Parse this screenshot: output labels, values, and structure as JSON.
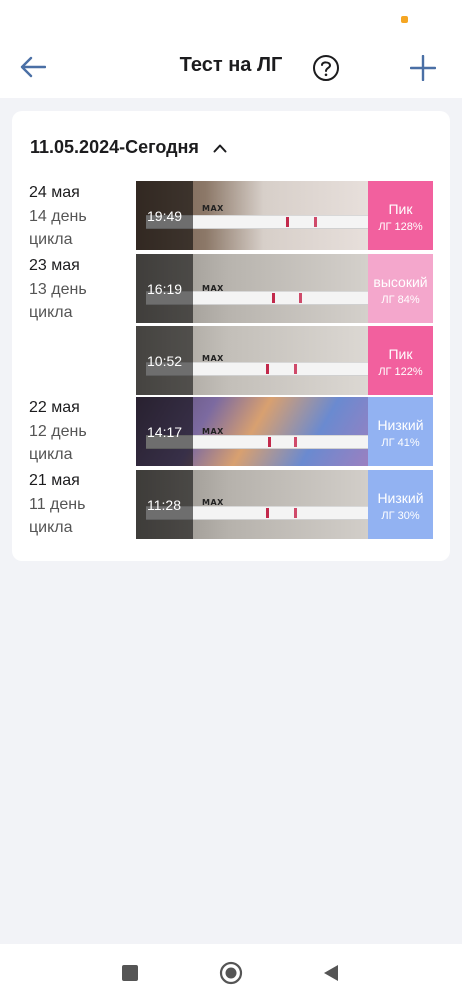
{
  "app": {
    "title": "Тест на ЛГ"
  },
  "range": {
    "label": "11.05.2024-Сегодня"
  },
  "days": [
    {
      "date": "24 мая",
      "cycle": "14 день цикла"
    },
    {
      "date": "23 мая",
      "cycle": "13 день цикла"
    },
    {
      "date": "22 мая",
      "cycle": "12 день цикла"
    },
    {
      "date": "21 мая",
      "cycle": "11 день цикла"
    }
  ],
  "entries": [
    {
      "time": "19:49",
      "label": "Пик",
      "value": "ЛГ 128%",
      "level_percent": 128,
      "color": "#f2609e"
    },
    {
      "time": "16:19",
      "label": "высокий",
      "value": "ЛГ 84%",
      "level_percent": 84,
      "color": "#f4a7cc"
    },
    {
      "time": "10:52",
      "label": "Пик",
      "value": "ЛГ 122%",
      "level_percent": 122,
      "color": "#f2609e"
    },
    {
      "time": "14:17",
      "label": "Низкий",
      "value": "ЛГ 41%",
      "level_percent": 41,
      "color": "#92b2f2"
    },
    {
      "time": "11:28",
      "label": "Низкий",
      "value": "ЛГ 30%",
      "level_percent": 30,
      "color": "#92b2f2"
    }
  ],
  "strip_mark": "MAX",
  "colors": {
    "accent": "#4a6fa5",
    "peak": "#f2609e",
    "high": "#f4a7cc",
    "low": "#92b2f2"
  },
  "icons": {
    "back": "arrow-left-icon",
    "help": "question-circle-icon",
    "add": "plus-icon",
    "collapse": "chevron-up-icon",
    "nav_recent": "square-icon",
    "nav_home": "circle-icon",
    "nav_back": "triangle-back-icon"
  }
}
